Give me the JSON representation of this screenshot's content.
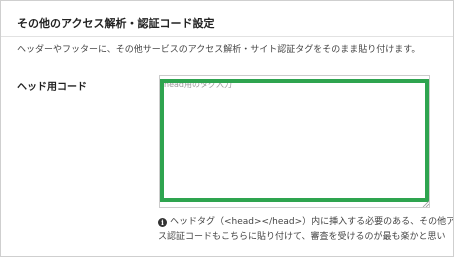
{
  "section": {
    "title": "その他のアクセス解析・認証コード設定",
    "description": "ヘッダーやフッターに、その他サービスのアクセス解析・サイト認証タグをそのまま貼り付けます。"
  },
  "head_code": {
    "label": "ヘッド用コード",
    "placeholder": "head用のタグ入力",
    "value": ""
  },
  "help": {
    "icon": "info-circle-icon",
    "line1": "ヘッドタグ（<head></head>）内に挿入する必要のある、その他アク",
    "line2": "ス認証コードもこちらに貼り付けて、審査を受けるのが最も楽かと思い"
  },
  "colors": {
    "highlight": "#2ea44f",
    "border": "#cccccc"
  }
}
